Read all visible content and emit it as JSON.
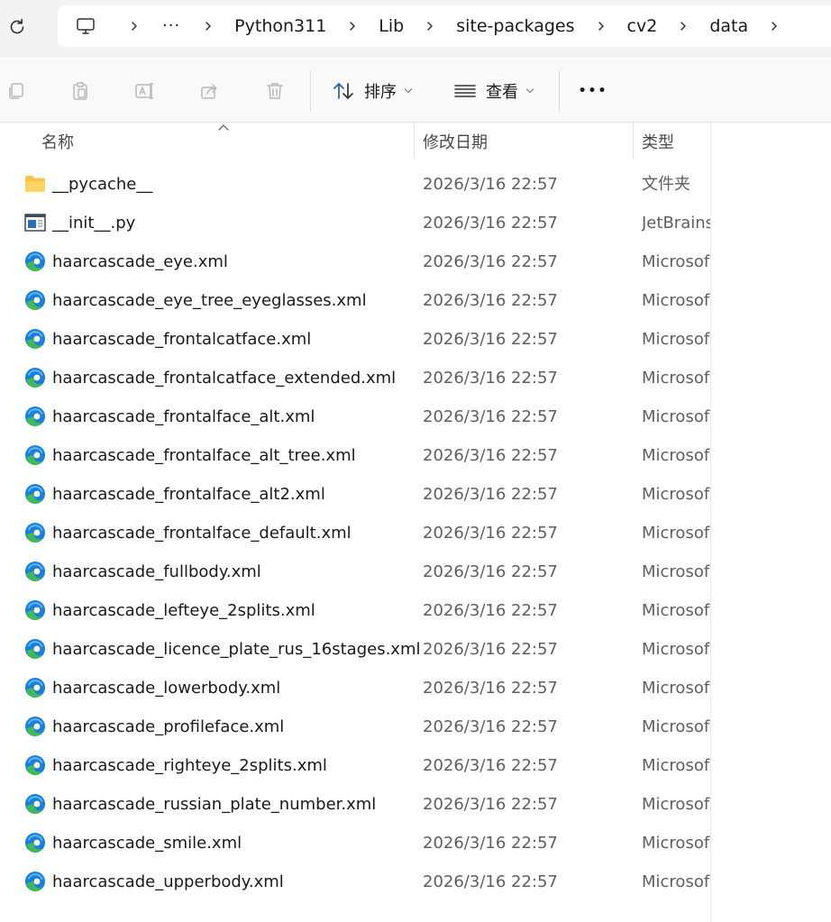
{
  "breadcrumb": {
    "more": "···",
    "items": [
      "Python311",
      "Lib",
      "site-packages",
      "cv2",
      "data"
    ]
  },
  "toolbar": {
    "sort_label": "排序",
    "view_label": "查看",
    "more_label": "•••"
  },
  "columns": {
    "name": "名称",
    "modified": "修改日期",
    "type": "类型"
  },
  "colors": {
    "folder": "#f8c54a",
    "edge_blue": "#1b7fd9",
    "edge_green": "#41b85a"
  },
  "files": [
    {
      "name": "__pycache__",
      "date": "2026/3/16 22:57",
      "type": "文件夹",
      "icon": "folder-icon"
    },
    {
      "name": "__init__.py",
      "date": "2026/3/16 22:57",
      "type": "JetBrains",
      "icon": "python-file-icon"
    },
    {
      "name": "haarcascade_eye.xml",
      "date": "2026/3/16 22:57",
      "type": "Microsof",
      "icon": "edge-xml-icon"
    },
    {
      "name": "haarcascade_eye_tree_eyeglasses.xml",
      "date": "2026/3/16 22:57",
      "type": "Microsof",
      "icon": "edge-xml-icon"
    },
    {
      "name": "haarcascade_frontalcatface.xml",
      "date": "2026/3/16 22:57",
      "type": "Microsof",
      "icon": "edge-xml-icon"
    },
    {
      "name": "haarcascade_frontalcatface_extended.xml",
      "date": "2026/3/16 22:57",
      "type": "Microsof",
      "icon": "edge-xml-icon"
    },
    {
      "name": "haarcascade_frontalface_alt.xml",
      "date": "2026/3/16 22:57",
      "type": "Microsof",
      "icon": "edge-xml-icon"
    },
    {
      "name": "haarcascade_frontalface_alt_tree.xml",
      "date": "2026/3/16 22:57",
      "type": "Microsof",
      "icon": "edge-xml-icon"
    },
    {
      "name": "haarcascade_frontalface_alt2.xml",
      "date": "2026/3/16 22:57",
      "type": "Microsof",
      "icon": "edge-xml-icon"
    },
    {
      "name": "haarcascade_frontalface_default.xml",
      "date": "2026/3/16 22:57",
      "type": "Microsof",
      "icon": "edge-xml-icon"
    },
    {
      "name": "haarcascade_fullbody.xml",
      "date": "2026/3/16 22:57",
      "type": "Microsof",
      "icon": "edge-xml-icon"
    },
    {
      "name": "haarcascade_lefteye_2splits.xml",
      "date": "2026/3/16 22:57",
      "type": "Microsof",
      "icon": "edge-xml-icon"
    },
    {
      "name": "haarcascade_licence_plate_rus_16stages.xml",
      "date": "2026/3/16 22:57",
      "type": "Microsof",
      "icon": "edge-xml-icon"
    },
    {
      "name": "haarcascade_lowerbody.xml",
      "date": "2026/3/16 22:57",
      "type": "Microsof",
      "icon": "edge-xml-icon"
    },
    {
      "name": "haarcascade_profileface.xml",
      "date": "2026/3/16 22:57",
      "type": "Microsof",
      "icon": "edge-xml-icon"
    },
    {
      "name": "haarcascade_righteye_2splits.xml",
      "date": "2026/3/16 22:57",
      "type": "Microsof",
      "icon": "edge-xml-icon"
    },
    {
      "name": "haarcascade_russian_plate_number.xml",
      "date": "2026/3/16 22:57",
      "type": "Microsof",
      "icon": "edge-xml-icon"
    },
    {
      "name": "haarcascade_smile.xml",
      "date": "2026/3/16 22:57",
      "type": "Microsof",
      "icon": "edge-xml-icon"
    },
    {
      "name": "haarcascade_upperbody.xml",
      "date": "2026/3/16 22:57",
      "type": "Microsof",
      "icon": "edge-xml-icon"
    }
  ]
}
